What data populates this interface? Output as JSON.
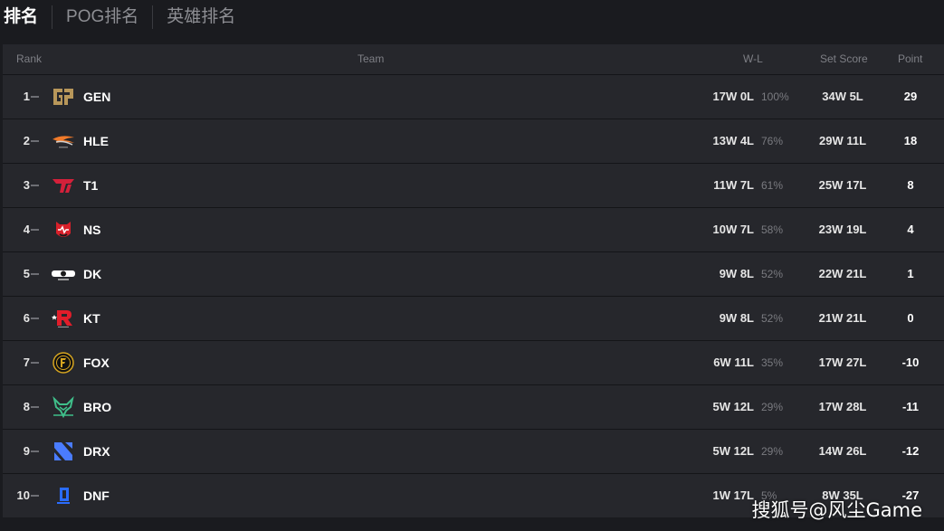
{
  "tabs": [
    {
      "label": "排名",
      "active": true
    },
    {
      "label": "POG排名",
      "active": false
    },
    {
      "label": "英雄排名",
      "active": false
    }
  ],
  "headers": {
    "rank": "Rank",
    "team": "Team",
    "wl": "W-L",
    "set_score": "Set Score",
    "point": "Point"
  },
  "rows": [
    {
      "rank": "1",
      "team": "GEN",
      "wl": "17W 0L",
      "pct": "100%",
      "set_score": "34W 5L",
      "point": "29",
      "logo": "gen-logo"
    },
    {
      "rank": "2",
      "team": "HLE",
      "wl": "13W 4L",
      "pct": "76%",
      "set_score": "29W 11L",
      "point": "18",
      "logo": "hle-logo"
    },
    {
      "rank": "3",
      "team": "T1",
      "wl": "11W 7L",
      "pct": "61%",
      "set_score": "25W 17L",
      "point": "8",
      "logo": "t1-logo"
    },
    {
      "rank": "4",
      "team": "NS",
      "wl": "10W 7L",
      "pct": "58%",
      "set_score": "23W 19L",
      "point": "4",
      "logo": "ns-logo"
    },
    {
      "rank": "5",
      "team": "DK",
      "wl": "9W 8L",
      "pct": "52%",
      "set_score": "22W 21L",
      "point": "1",
      "logo": "dk-logo"
    },
    {
      "rank": "6",
      "team": "KT",
      "wl": "9W 8L",
      "pct": "52%",
      "set_score": "21W 21L",
      "point": "0",
      "logo": "kt-logo"
    },
    {
      "rank": "7",
      "team": "FOX",
      "wl": "6W 11L",
      "pct": "35%",
      "set_score": "17W 27L",
      "point": "-10",
      "logo": "fox-logo"
    },
    {
      "rank": "8",
      "team": "BRO",
      "wl": "5W 12L",
      "pct": "29%",
      "set_score": "17W 28L",
      "point": "-11",
      "logo": "bro-logo"
    },
    {
      "rank": "9",
      "team": "DRX",
      "wl": "5W 12L",
      "pct": "29%",
      "set_score": "14W 26L",
      "point": "-12",
      "logo": "drx-logo"
    },
    {
      "rank": "10",
      "team": "DNF",
      "wl": "1W 17L",
      "pct": "5%",
      "set_score": "8W 35L",
      "point": "-27",
      "logo": "dnf-logo"
    }
  ],
  "watermark": "搜狐号@风尘Game",
  "colors": {
    "background": "#1a1b1f",
    "row": "#26272c",
    "active_tab": "#ffffff",
    "muted": "#7e7f85"
  }
}
